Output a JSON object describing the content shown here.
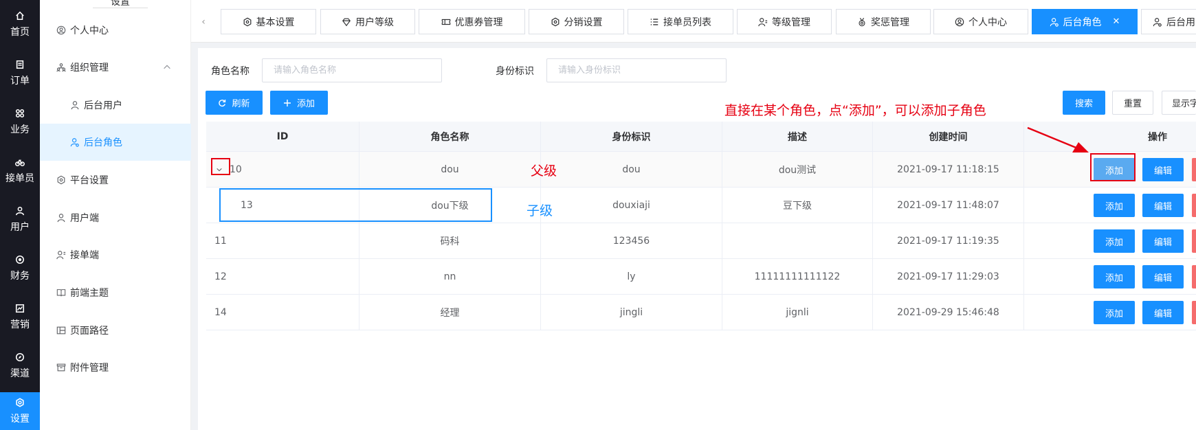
{
  "rail": {
    "items": [
      {
        "label": "首页",
        "icon": "home-icon"
      },
      {
        "label": "订单",
        "icon": "order-icon"
      },
      {
        "label": "业务",
        "icon": "grid-icon"
      },
      {
        "label": "接单员",
        "icon": "bike-icon"
      },
      {
        "label": "用户",
        "icon": "user-icon"
      },
      {
        "label": "财务",
        "icon": "finance-icon"
      },
      {
        "label": "营销",
        "icon": "chart-icon"
      },
      {
        "label": "渠道",
        "icon": "compass-icon"
      },
      {
        "label": "设置",
        "icon": "settings-icon"
      }
    ]
  },
  "side": {
    "head": "设置",
    "items": [
      {
        "label": "个人中心"
      },
      {
        "label": "组织管理"
      },
      {
        "label": "后台用户"
      },
      {
        "label": "后台角色"
      },
      {
        "label": "平台设置"
      },
      {
        "label": "用户端"
      },
      {
        "label": "接单端"
      },
      {
        "label": "前端主题"
      },
      {
        "label": "页面路径"
      },
      {
        "label": "附件管理"
      }
    ]
  },
  "tabs": [
    {
      "label": "基本设置"
    },
    {
      "label": "用户等级"
    },
    {
      "label": "优惠券管理"
    },
    {
      "label": "分销设置"
    },
    {
      "label": "接单员列表"
    },
    {
      "label": "等级管理"
    },
    {
      "label": "奖惩管理"
    },
    {
      "label": "个人中心"
    },
    {
      "label": "后台角色"
    },
    {
      "label": "后台用"
    }
  ],
  "search": {
    "role_name_label": "角色名称",
    "role_name_placeholder": "请输入角色名称",
    "identity_label": "身份标识",
    "identity_placeholder": "请输入身份标识",
    "refresh": "刷新",
    "add": "添加",
    "search": "搜索",
    "reset": "重置",
    "show": "显示字"
  },
  "table": {
    "headers": [
      "ID",
      "角色名称",
      "身份标识",
      "描述",
      "创建时间",
      "操作"
    ],
    "rows": [
      {
        "id": "10",
        "name": "dou",
        "identity": "dou",
        "desc": "dou测试",
        "time": "2021-09-17 11:18:15"
      },
      {
        "id": "13",
        "name": "dou下级",
        "identity": "douxiaji",
        "desc": "豆下级",
        "time": "2021-09-17 11:48:07"
      },
      {
        "id": "11",
        "name": "码科",
        "identity": "123456",
        "desc": "",
        "time": "2021-09-17 11:19:35"
      },
      {
        "id": "12",
        "name": "nn",
        "identity": "ly",
        "desc": "11111111111122",
        "time": "2021-09-17 11:29:03"
      },
      {
        "id": "14",
        "name": "经理",
        "identity": "jingli",
        "desc": "jignli",
        "time": "2021-09-29 15:46:48"
      }
    ],
    "op_add": "添加",
    "op_edit": "编辑"
  },
  "annotations": {
    "tip": "直接在某个角色，点“添加”，可以添加子角色",
    "parent": "父级",
    "child": "子级"
  },
  "colors": {
    "accent": "#1890ff",
    "rail_bg": "#191a23",
    "annotation_red": "#e60012"
  }
}
